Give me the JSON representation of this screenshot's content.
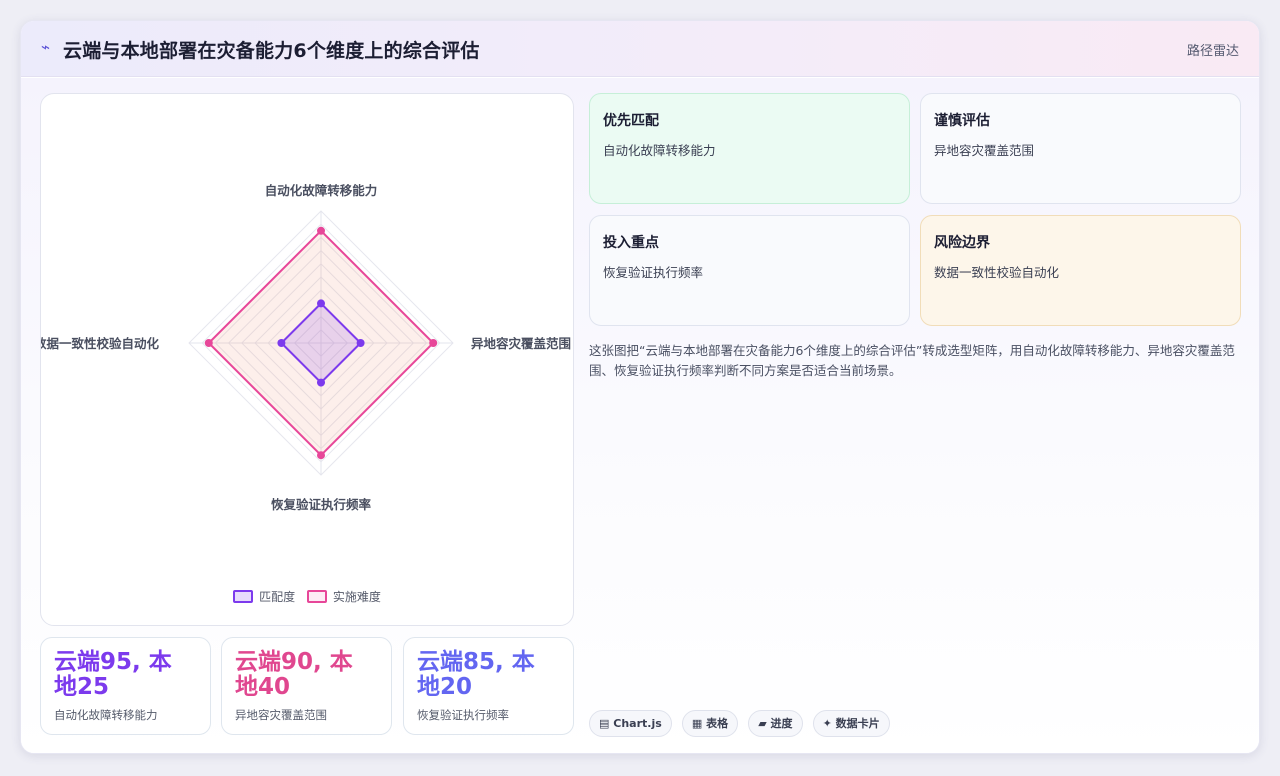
{
  "header": {
    "title": "云端与本地部署在灾备能力6个维度上的综合评估",
    "tag": "路径雷达",
    "logo_icon": "trend-icon"
  },
  "chart_data": {
    "type": "radar",
    "axes": [
      "自动化故障转移能力",
      "异地容灾覆盖范围",
      "恢复验证执行频率",
      "数据一致性校验自动化"
    ],
    "series": [
      {
        "name": "匹配度",
        "values": [
          30,
          30,
          30,
          30
        ],
        "color": "#7c3aed"
      },
      {
        "name": "实施难度",
        "values": [
          85,
          85,
          85,
          85
        ],
        "color": "#e74799"
      }
    ],
    "range": [
      0,
      100
    ],
    "grid": true,
    "legend": "bottom"
  },
  "stats": [
    {
      "line1": "云端95, 本",
      "line2": "地25",
      "label": "自动化故障转移能力",
      "color": "#7c3aed"
    },
    {
      "line1": "云端90, 本",
      "line2": "地40",
      "label": "异地容灾覆盖范围",
      "color": "#e0478f"
    },
    {
      "line1": "云端85, 本",
      "line2": "地20",
      "label": "恢复验证执行频率",
      "color": "#6366f1"
    }
  ],
  "cards": [
    {
      "title": "优先匹配",
      "value": "自动化故障转移能力"
    },
    {
      "title": "谨慎评估",
      "value": "异地容灾覆盖范围"
    },
    {
      "title": "投入重点",
      "value": "恢复验证执行频率"
    },
    {
      "title": "风险边界",
      "value": "数据一致性校验自动化"
    }
  ],
  "description": "这张图把“云端与本地部署在灾备能力6个维度上的综合评估”转成选型矩阵，用自动化故障转移能力、异地容灾覆盖范围、恢复验证执行频率判断不同方案是否适合当前场景。",
  "chips": [
    {
      "icon": "▤",
      "label": "Chart.js"
    },
    {
      "icon": "▦",
      "label": "表格"
    },
    {
      "icon": "▰",
      "label": "进度"
    },
    {
      "icon": "✦",
      "label": "数据卡片"
    }
  ]
}
